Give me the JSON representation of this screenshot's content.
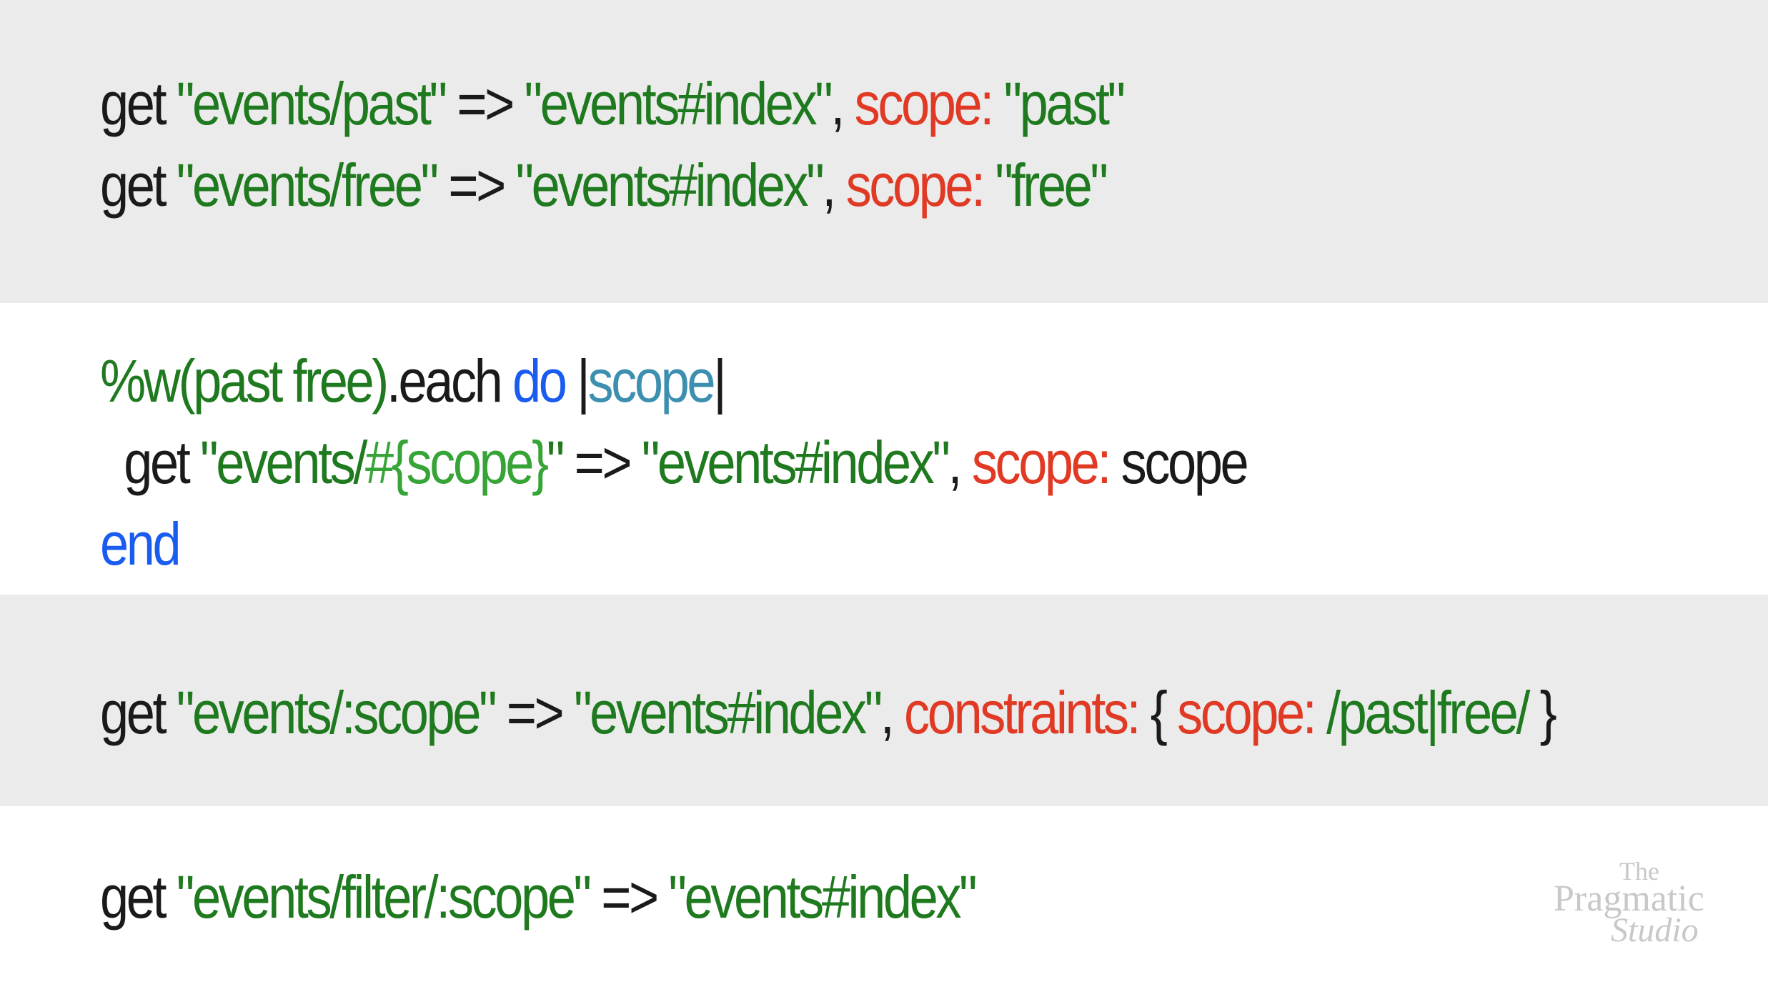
{
  "section_1": {
    "line_1": {
      "a": "get ",
      "b": "\"events/past\"",
      "c": " => ",
      "d": "\"events#index\"",
      "e": ", ",
      "f": "scope: ",
      "g": "\"past\""
    },
    "line_2": {
      "a": "get ",
      "b": "\"events/free\"",
      "c": " => ",
      "d": "\"events#index\"",
      "e": ", ",
      "f": "scope: ",
      "g": "\"free\""
    }
  },
  "section_2": {
    "line_1": {
      "a": "%w(past free)",
      "b": ".each ",
      "c": "do",
      "d": " |",
      "e": "scope",
      "f": "|"
    },
    "line_2": {
      "a": "  get ",
      "b": "\"events/",
      "c": "#{scope}",
      "d": "\"",
      "e": " => ",
      "f": "\"events#index\"",
      "g": ", ",
      "h": "scope: ",
      "i": "scope"
    },
    "line_3": {
      "a": "end"
    }
  },
  "section_3": {
    "line_1": {
      "a": "get ",
      "b": "\"events/:scope\"",
      "c": " => ",
      "d": "\"events#index\"",
      "e": ", ",
      "f": "constraints: ",
      "g": "{ ",
      "h": "scope: ",
      "i": "/past|free/",
      "j": " }"
    }
  },
  "section_4": {
    "line_1": {
      "a": "get ",
      "b": "\"events/filter/:scope\"",
      "c": " => ",
      "d": "\"events#index\""
    }
  },
  "brand": {
    "the": "The",
    "pragmatic": "Pragmatic",
    "studio": "Studio"
  },
  "colors": {
    "keyword": "#1a1a1a",
    "string": "#1f7a1f",
    "symbol_key": "#e03a25",
    "ruby_keyword": "#1a5cf0",
    "block_param": "#3d8fb0",
    "interpolation": "#36a436",
    "band_gray": "#ebebeb",
    "band_white": "#ffffff"
  }
}
